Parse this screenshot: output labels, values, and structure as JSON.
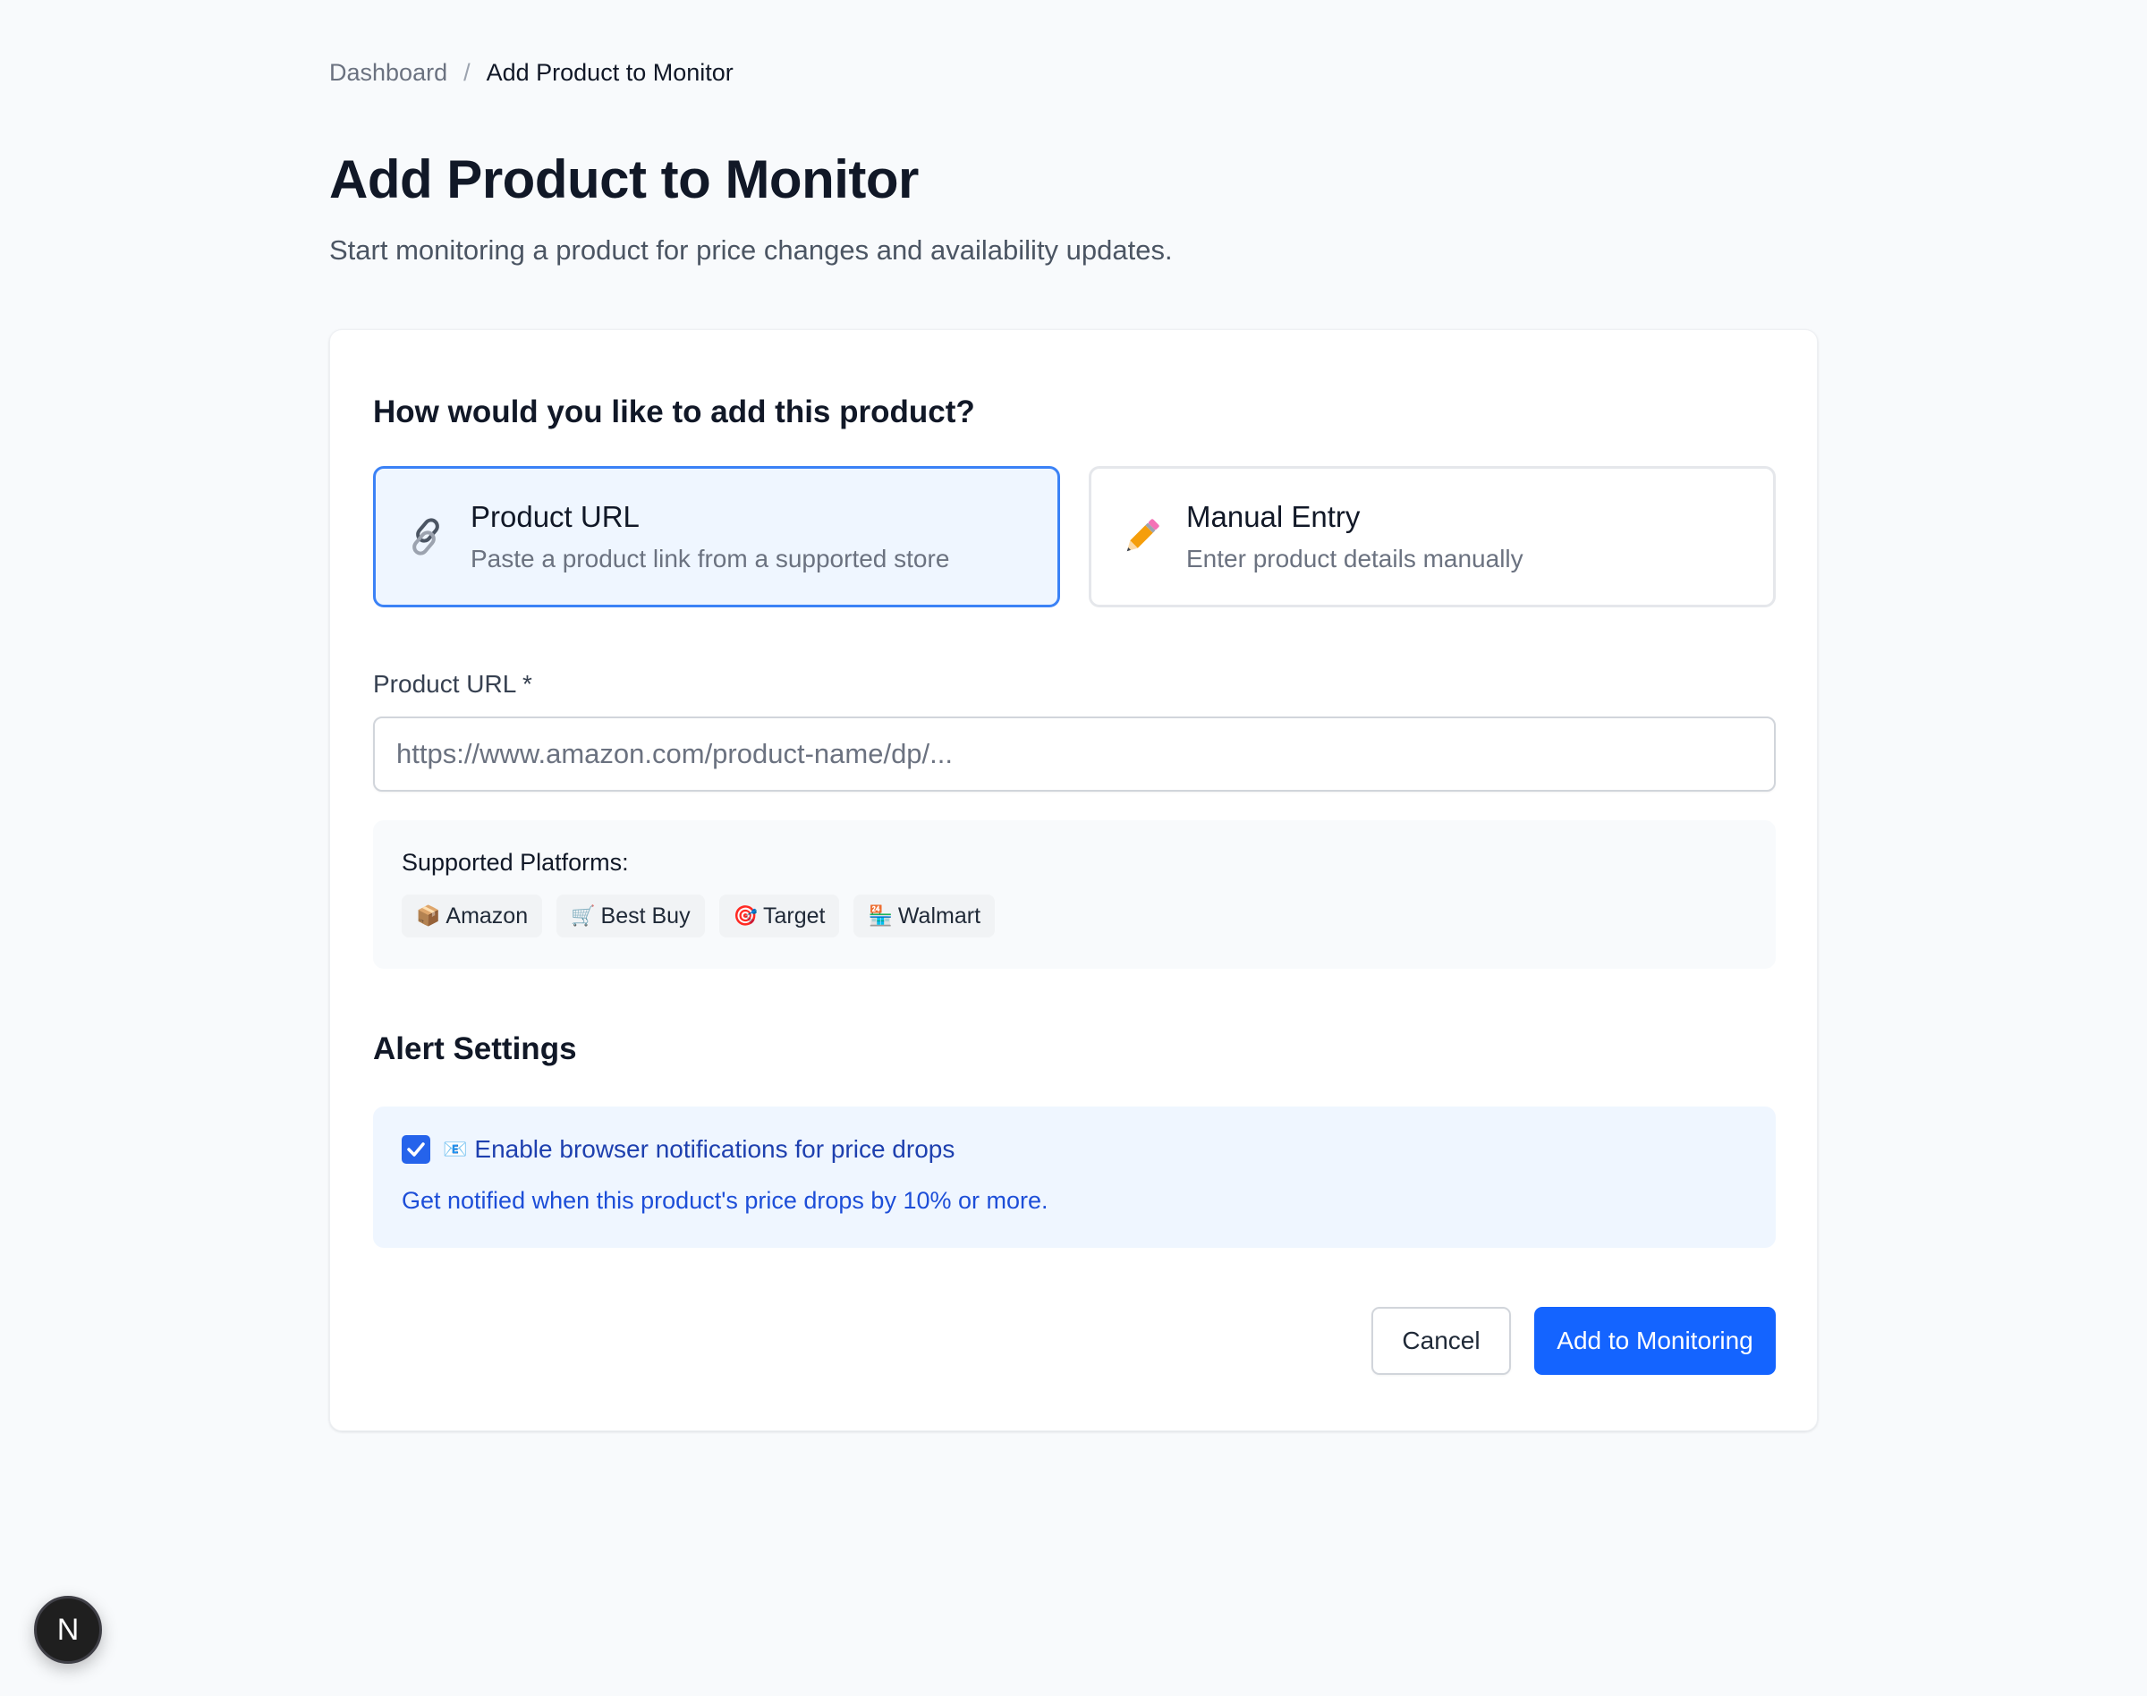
{
  "breadcrumb": {
    "parent": "Dashboard",
    "separator": "/",
    "current": "Add Product to Monitor"
  },
  "page": {
    "title": "Add Product to Monitor",
    "subtitle": "Start monitoring a product for price changes and availability updates."
  },
  "method": {
    "question": "How would you like to add this product?",
    "options": [
      {
        "title": "Product URL",
        "description": "Paste a product link from a supported store",
        "icon": "link-icon",
        "selected": true
      },
      {
        "title": "Manual Entry",
        "description": "Enter product details manually",
        "icon": "pencil-icon",
        "selected": false
      }
    ]
  },
  "url_field": {
    "label": "Product URL *",
    "value": "",
    "placeholder": "https://www.amazon.com/product-name/dp/..."
  },
  "platforms": {
    "title": "Supported Platforms:",
    "items": [
      {
        "name": "Amazon",
        "icon": "package-icon",
        "glyph": "📦"
      },
      {
        "name": "Best Buy",
        "icon": "cart-icon",
        "glyph": "🛒"
      },
      {
        "name": "Target",
        "icon": "target-icon",
        "glyph": "🎯"
      },
      {
        "name": "Walmart",
        "icon": "store-icon",
        "glyph": "🏪"
      }
    ]
  },
  "alerts": {
    "section_title": "Alert Settings",
    "checkbox_checked": true,
    "notification_glyph": "📧",
    "label": "Enable browser notifications for price drops",
    "description": "Get notified when this product's price drops by 10% or more."
  },
  "actions": {
    "cancel_label": "Cancel",
    "submit_label": "Add to Monitoring"
  },
  "dev_badge": {
    "letter": "N"
  },
  "colors": {
    "accent": "#1464ff",
    "selected_border": "#3b82f6",
    "selected_bg": "#eff6ff",
    "alert_text": "#1d4ed8"
  }
}
